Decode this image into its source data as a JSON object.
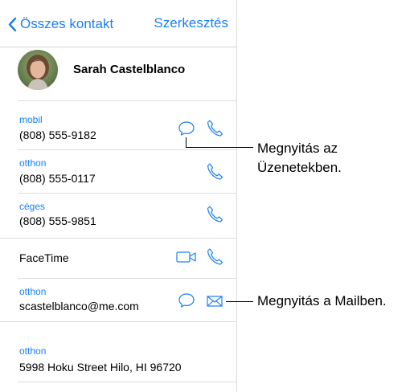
{
  "nav": {
    "back_label": "Összes kontakt",
    "edit_label": "Szerkesztés"
  },
  "contact": {
    "name": "Sarah Castelblanco"
  },
  "phones": [
    {
      "label": "mobil",
      "number": "(808) 555-9182"
    },
    {
      "label": "otthon",
      "number": "(808) 555-0117"
    },
    {
      "label": "céges",
      "number": "(808) 555-9851"
    }
  ],
  "facetime": {
    "label": "FaceTime"
  },
  "email": {
    "label": "otthon",
    "address": "scastelblanco@me.com"
  },
  "address": {
    "label": "otthon",
    "line": "5998 Hoku Street Hilo, HI 96720"
  },
  "callouts": {
    "messages_line1": "Megnyitás az",
    "messages_line2": "Üzenetekben.",
    "mail": "Megnyitás a Mailben."
  },
  "colors": {
    "accent": "#1a7ff6",
    "separator": "#dcdcdc",
    "text": "#000000"
  },
  "icons": [
    "chevron-left-icon",
    "message-icon",
    "phone-icon",
    "video-icon",
    "mail-icon",
    "avatar-photo"
  ]
}
